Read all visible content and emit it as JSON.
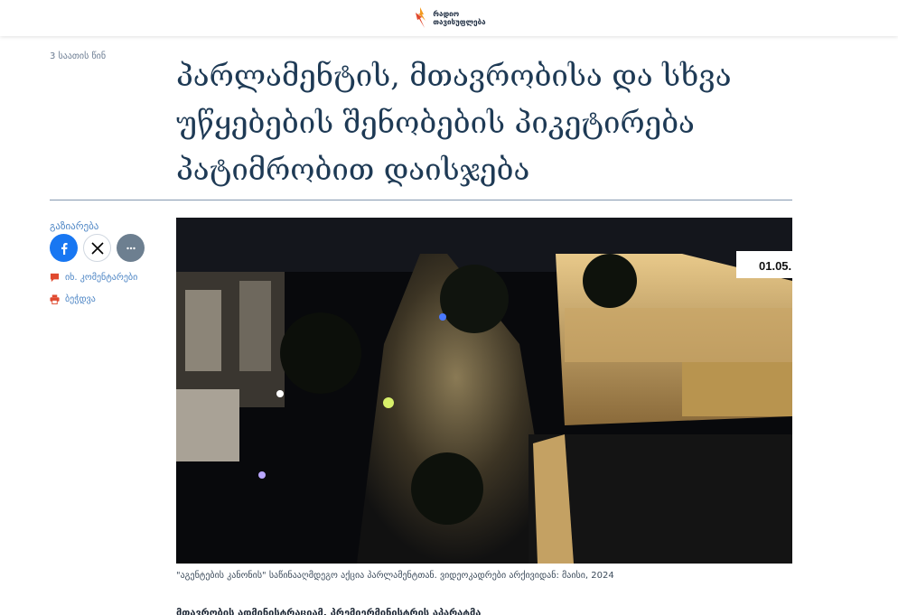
{
  "header": {
    "logo_line1": "რადიო",
    "logo_line2": "თავისუფლება"
  },
  "article": {
    "timestamp": "3 საათის წინ",
    "headline": "პარლამენტის, მთავრობისა და სხვა უწყებების შენობების პიკეტირება პატიმრობით დაისჯება",
    "video_overlay_date": "01.05.",
    "caption": "\"აგენტების კანონის\" საწინააღმდეგო აქცია პარლამენტთან. ვიდეოკადრები არქივიდან: მაისი, 2024",
    "lead_text": "მთავრობის ადმინისტრაციამ, პრემიერმინისტრის აპარატმა"
  },
  "share": {
    "label": "გაზიარება",
    "facebook_icon": "facebook-icon",
    "x_icon": "x-icon",
    "more_icon": "more-icon"
  },
  "actions": {
    "comments_label": "იხ. კომენტარები",
    "print_label": "ბეჭდვა"
  },
  "colors": {
    "headline": "#1e3a55",
    "accent_link": "#4b84c4",
    "icon_orange": "#e0492e",
    "facebook": "#1877f2"
  }
}
